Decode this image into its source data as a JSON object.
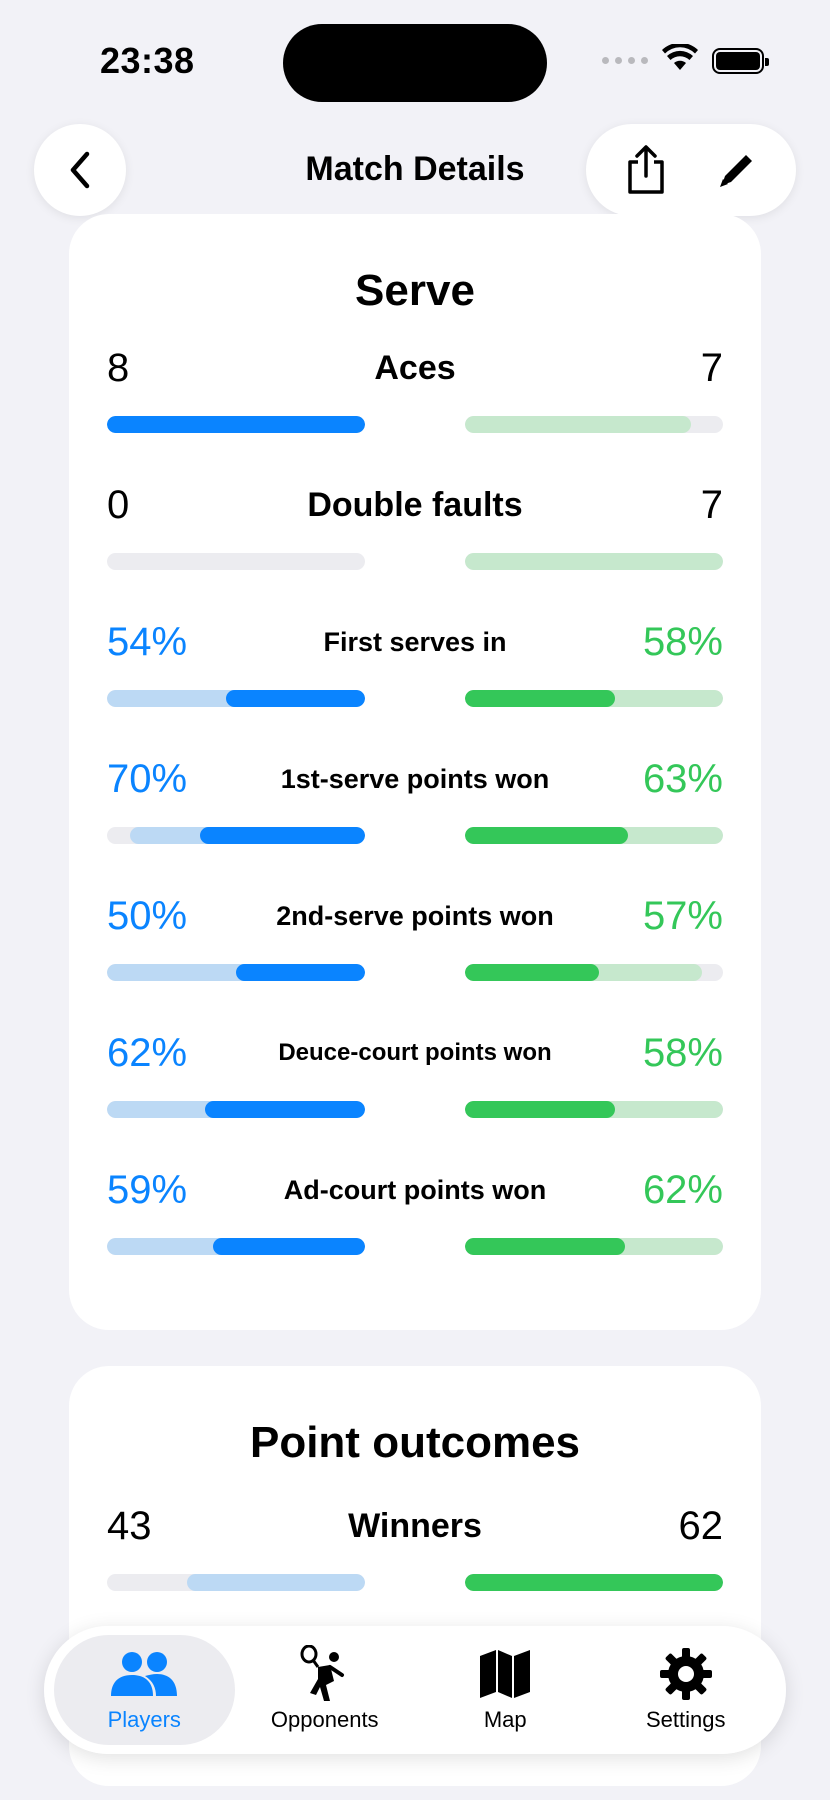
{
  "status": {
    "time": "23:38"
  },
  "nav": {
    "title": "Match Details"
  },
  "colors": {
    "player": "#0a84ff",
    "player_light": "#bcd9f4",
    "opponent": "#34c759",
    "opponent_light": "#c6e8cd",
    "track": "#ececf0"
  },
  "serve": {
    "title": "Serve",
    "stats": [
      {
        "label": "Aces",
        "left": "8",
        "right": "7"
      },
      {
        "label": "Double faults",
        "left": "0",
        "right": "7"
      },
      {
        "label": "First serves in",
        "left": "54%",
        "right": "58%"
      },
      {
        "label": "1st-serve points won",
        "left": "70%",
        "right": "63%"
      },
      {
        "label": "2nd-serve points won",
        "left": "50%",
        "right": "57%"
      },
      {
        "label": "Deuce-court points won",
        "left": "62%",
        "right": "58%"
      },
      {
        "label": "Ad-court points won",
        "left": "59%",
        "right": "62%"
      }
    ]
  },
  "outcomes": {
    "title": "Point outcomes",
    "stats": [
      {
        "label": "Winners",
        "left": "43",
        "right": "62"
      }
    ]
  },
  "tabs": [
    {
      "label": "Players",
      "icon": "players-icon",
      "active": true
    },
    {
      "label": "Opponents",
      "icon": "tennis-player-icon",
      "active": false
    },
    {
      "label": "Map",
      "icon": "map-icon",
      "active": false
    },
    {
      "label": "Settings",
      "icon": "gear-icon",
      "active": false
    }
  ]
}
